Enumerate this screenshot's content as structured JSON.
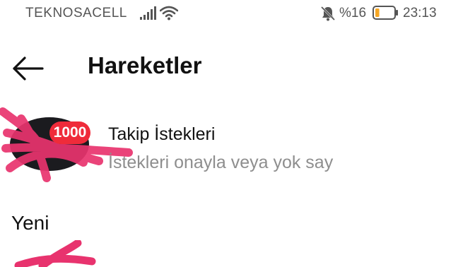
{
  "status_bar": {
    "carrier": "TEKNOSACELL",
    "battery_percent": "%16",
    "battery_level": 0.16,
    "time": "23:13",
    "icons": [
      "signal-icon",
      "wifi-icon",
      "notifications-muted-icon",
      "battery-icon"
    ]
  },
  "header": {
    "title": "Hareketler",
    "back_icon": "arrow-left-icon"
  },
  "follow_requests": {
    "badge_count": "1000",
    "title": "Takip İstekleri",
    "subtitle": "İstekleri onayla veya yok say"
  },
  "sections": {
    "new_heading": "Yeni"
  },
  "colors": {
    "badge": "#ef2b3a",
    "battery_low": "#f5a623",
    "scribble": "#e8336e",
    "subtitle_text": "#8e8e8e"
  }
}
